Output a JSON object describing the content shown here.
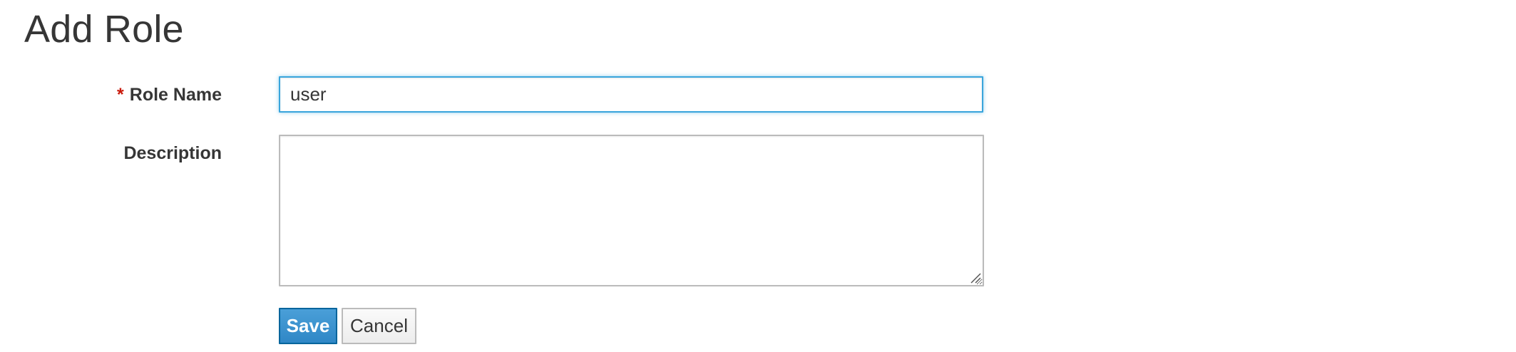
{
  "page": {
    "title": "Add Role"
  },
  "form": {
    "role_name": {
      "required_marker": "*",
      "label": "Role Name",
      "value": "user"
    },
    "description": {
      "label": "Description",
      "value": ""
    },
    "save_label": "Save",
    "cancel_label": "Cancel"
  },
  "colors": {
    "accent": "#39a5dc",
    "primary_button": "#3c8fca",
    "required": "#c9190b"
  }
}
